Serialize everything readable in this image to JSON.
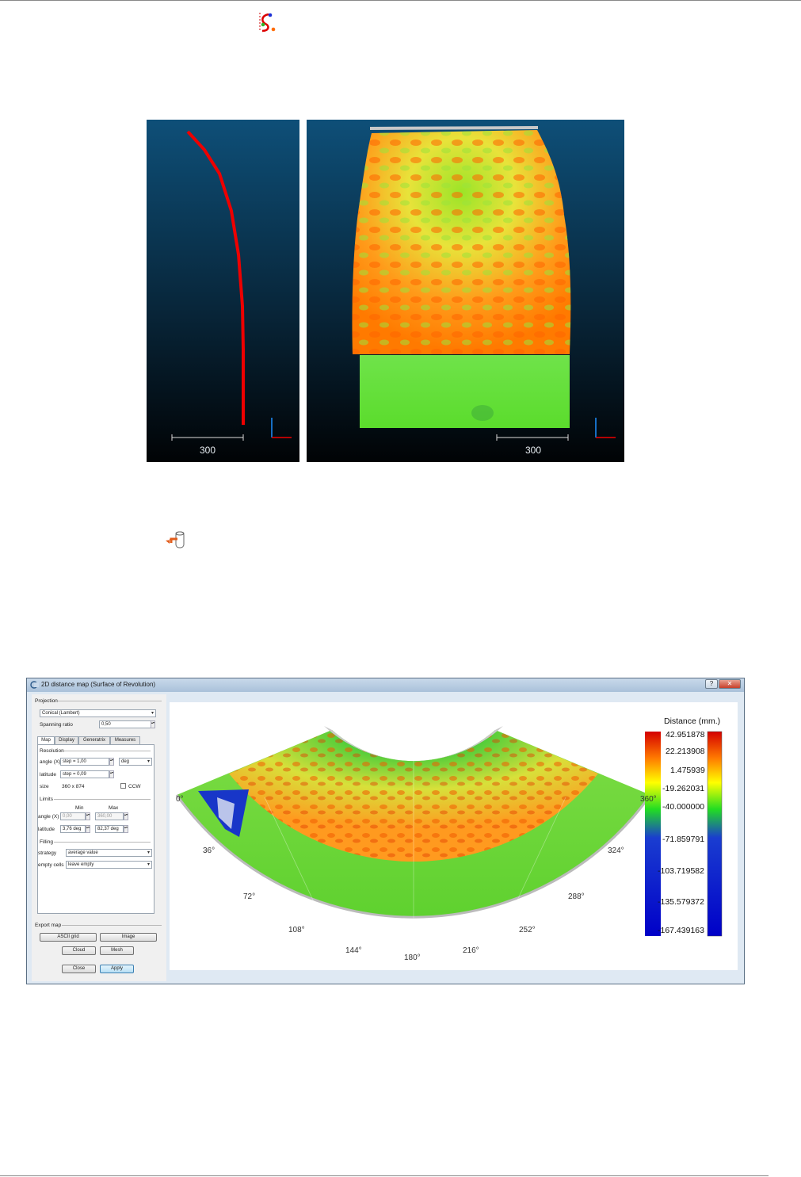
{
  "fig1": {
    "left_scale_label": "300",
    "right_scale_label": "300"
  },
  "dialog": {
    "title": "2D distance map (Surface of Revolution)",
    "projection_group": "Projection",
    "projection_value": "Conical (Lambert)",
    "spanning_ratio_label": "Spanning ratio",
    "spanning_ratio_value": "0,50",
    "tabs": [
      "Map",
      "Display",
      "Generatrix",
      "Measures"
    ],
    "resolution_group": "Resolution",
    "angle_label": "angle (X)",
    "angle_step": "step = 1,00",
    "angle_unit": "deg",
    "latitude_label": "latitude",
    "latitude_step": "step = 0,09",
    "size_label": "size",
    "size_value": "360 x 874",
    "ccw_label": "CCW",
    "limits_group": "Limits",
    "min_header": "Min",
    "max_header": "Max",
    "limit_angle_min": "0,00",
    "limit_angle_max": "360,00",
    "limit_lat_min": "3,76 deg",
    "limit_lat_max": "82,37 deg",
    "filling_group": "Filling",
    "strategy_label": "strategy",
    "strategy_value": "average value",
    "empty_cells_label": "empty cells",
    "empty_cells_value": "leave empty",
    "export_group": "Export map",
    "btn_ascii": "ASCII grid",
    "btn_image": "Image",
    "btn_cloud": "Cloud",
    "btn_mesh": "Mesh",
    "btn_close": "Close",
    "btn_apply": "Apply"
  },
  "map": {
    "angle_labels": [
      "0°",
      "36°",
      "72°",
      "108°",
      "144°",
      "180°",
      "216°",
      "252°",
      "288°",
      "324°",
      "360°"
    ],
    "colorbar_title": "Distance (mm.)",
    "colorbar_ticks": [
      "42.951878",
      "22.213908",
      "1.475939",
      "-19.262031",
      "-40.000000",
      "-71.859791",
      "-103.719582",
      "-135.579372",
      "-167.439163"
    ],
    "colorbar_colors": [
      "#d40000",
      "#ff7a00",
      "#ffff00",
      "#22dd22",
      "#1a3dd0",
      "#0000c8"
    ]
  }
}
